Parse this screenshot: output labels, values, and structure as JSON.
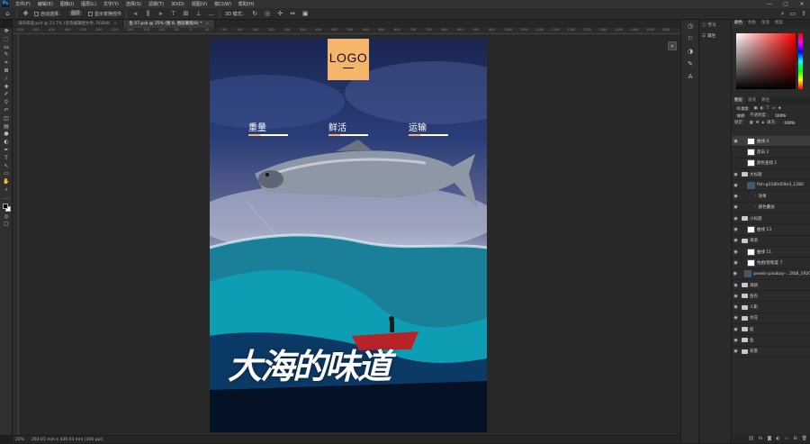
{
  "menubar": {
    "logo": "Ps",
    "items": [
      "文件(F)",
      "编辑(E)",
      "图像(I)",
      "图层(L)",
      "文字(Y)",
      "选择(S)",
      "滤镜(T)",
      "3D(D)",
      "视图(V)",
      "窗口(W)",
      "帮助(H)"
    ],
    "window_controls": [
      "—",
      "▢",
      "✕"
    ]
  },
  "options": {
    "auto_select_label": "自动选择：",
    "auto_select_value": "图层",
    "transform_label": "显示变换控件",
    "mode_3d": "3D 模式："
  },
  "tabs": [
    {
      "label": "海的味道.psd @ 21.7% (背景编辑图文件, RGB/8)",
      "active": false
    },
    {
      "label": "鱼 07.psb @ 25% (图 8, 图层蒙版/8) *",
      "active": true
    }
  ],
  "ruler_top": [
    "-550",
    "-500",
    "-450",
    "-400",
    "-350",
    "-300",
    "-250",
    "-200",
    "-150",
    "-100",
    "-50",
    "0",
    "50",
    "100",
    "150",
    "200",
    "250",
    "300",
    "350",
    "400",
    "450",
    "500",
    "550",
    "600",
    "650",
    "700",
    "750",
    "800",
    "850",
    "900",
    "950",
    "1000",
    "1050",
    "1100",
    "1150",
    "1200",
    "1250",
    "1300",
    "1350",
    "1400",
    "1450",
    "1500"
  ],
  "poster": {
    "logo": "LOGO",
    "nav": [
      "重量",
      "鲜活",
      "运输"
    ],
    "nav_colors": [
      "#f5b56a",
      "#f5b56a",
      "#f5b56a"
    ],
    "headline": "大海的味道"
  },
  "status": {
    "zoom": "25%",
    "info": "263.01 mm x 436.03 mm (300 ppi)"
  },
  "panels": {
    "color_tabs": [
      "颜色",
      "色板",
      "渐变",
      "图案"
    ],
    "prop_items": [
      "学习",
      "属性"
    ],
    "layer_tabs": [
      "图层",
      "通道",
      "路径"
    ],
    "kind_label": "Q 类型",
    "blend_mode": "穿透",
    "opacity_label": "不透明度：",
    "opacity": "100%",
    "lock_label": "锁定：",
    "fill_label": "填充：",
    "fill": "100%"
  },
  "layers": [
    {
      "name": "曲线 4",
      "visible": true,
      "type": "adj",
      "selected": true
    },
    {
      "name": "黑白 2",
      "visible": false,
      "type": "adj",
      "selected": false
    },
    {
      "name": "颜色查找 1",
      "visible": false,
      "type": "adj",
      "selected": false
    },
    {
      "name": "大标题",
      "visible": true,
      "type": "folder",
      "selected": false
    },
    {
      "name": "fish-g2180d59e3_1280",
      "visible": true,
      "type": "img",
      "selected": false
    },
    {
      "name": "效果",
      "visible": true,
      "type": "fx",
      "selected": false
    },
    {
      "name": "颜色叠加",
      "visible": true,
      "type": "fx",
      "selected": false
    },
    {
      "name": "小标题",
      "visible": true,
      "type": "folder",
      "selected": false
    },
    {
      "name": "曲线 13",
      "visible": true,
      "type": "adj",
      "selected": false
    },
    {
      "name": "海浪",
      "visible": true,
      "type": "folder",
      "selected": false
    },
    {
      "name": "曲线 11",
      "visible": true,
      "type": "adj",
      "selected": false
    },
    {
      "name": "色相/饱和度 7",
      "visible": true,
      "type": "adj",
      "selected": false
    },
    {
      "name": "pexels-pixabay-...2fb8_1920",
      "visible": true,
      "type": "img",
      "selected": false
    },
    {
      "name": "海鸥",
      "visible": true,
      "type": "folder",
      "selected": false
    },
    {
      "name": "鱼钓",
      "visible": true,
      "type": "folder",
      "selected": false
    },
    {
      "name": "人影",
      "visible": true,
      "type": "folder",
      "selected": false
    },
    {
      "name": "水花",
      "visible": true,
      "type": "folder",
      "selected": false
    },
    {
      "name": "船",
      "visible": true,
      "type": "folder",
      "selected": false
    },
    {
      "name": "鱼",
      "visible": true,
      "type": "folder",
      "selected": false
    },
    {
      "name": "背景",
      "visible": true,
      "type": "folder",
      "selected": false
    }
  ]
}
